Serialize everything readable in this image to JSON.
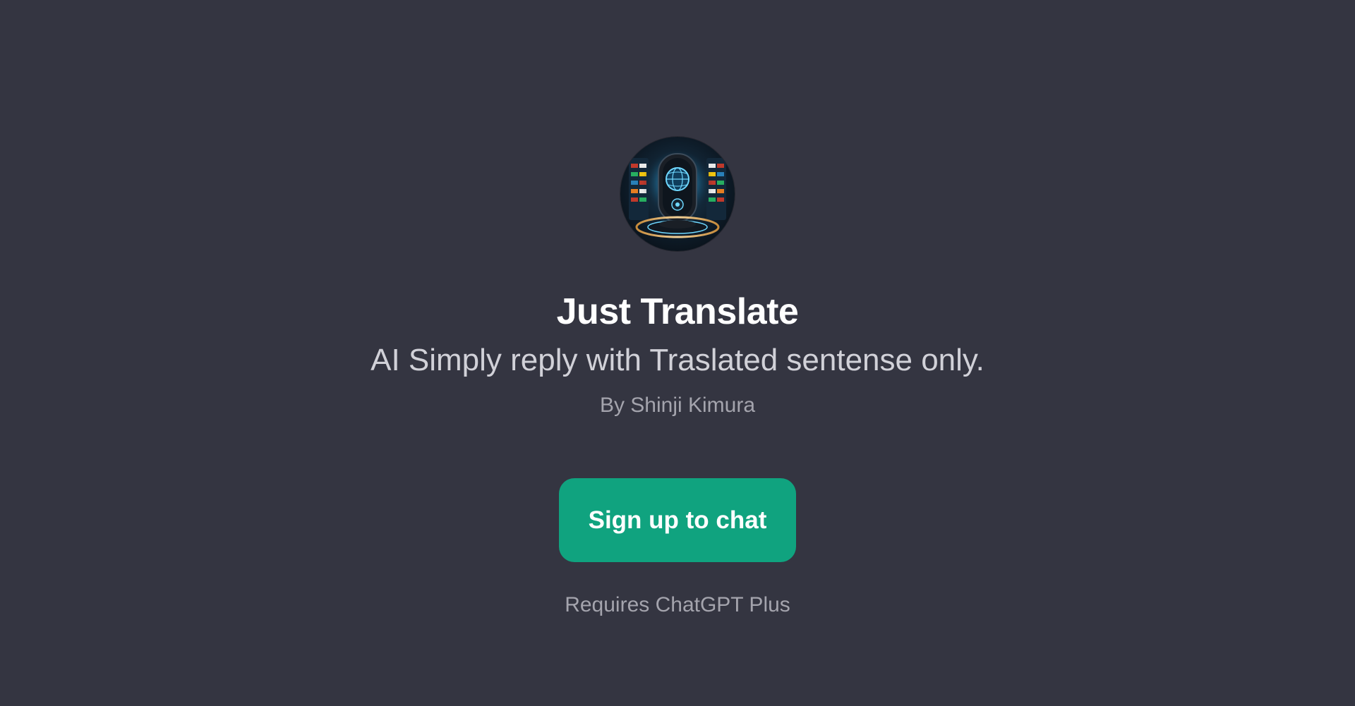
{
  "gpt": {
    "avatar_icon": "robot-globe-avatar-icon",
    "title": "Just Translate",
    "description": "AI Simply reply with Traslated sentense only.",
    "author": "By Shinji Kimura"
  },
  "cta": {
    "signup_label": "Sign up to chat",
    "requirement": "Requires ChatGPT Plus"
  },
  "colors": {
    "background": "#343541",
    "button": "#10a37f",
    "title": "#ffffff",
    "muted": "#a4a4ad"
  }
}
